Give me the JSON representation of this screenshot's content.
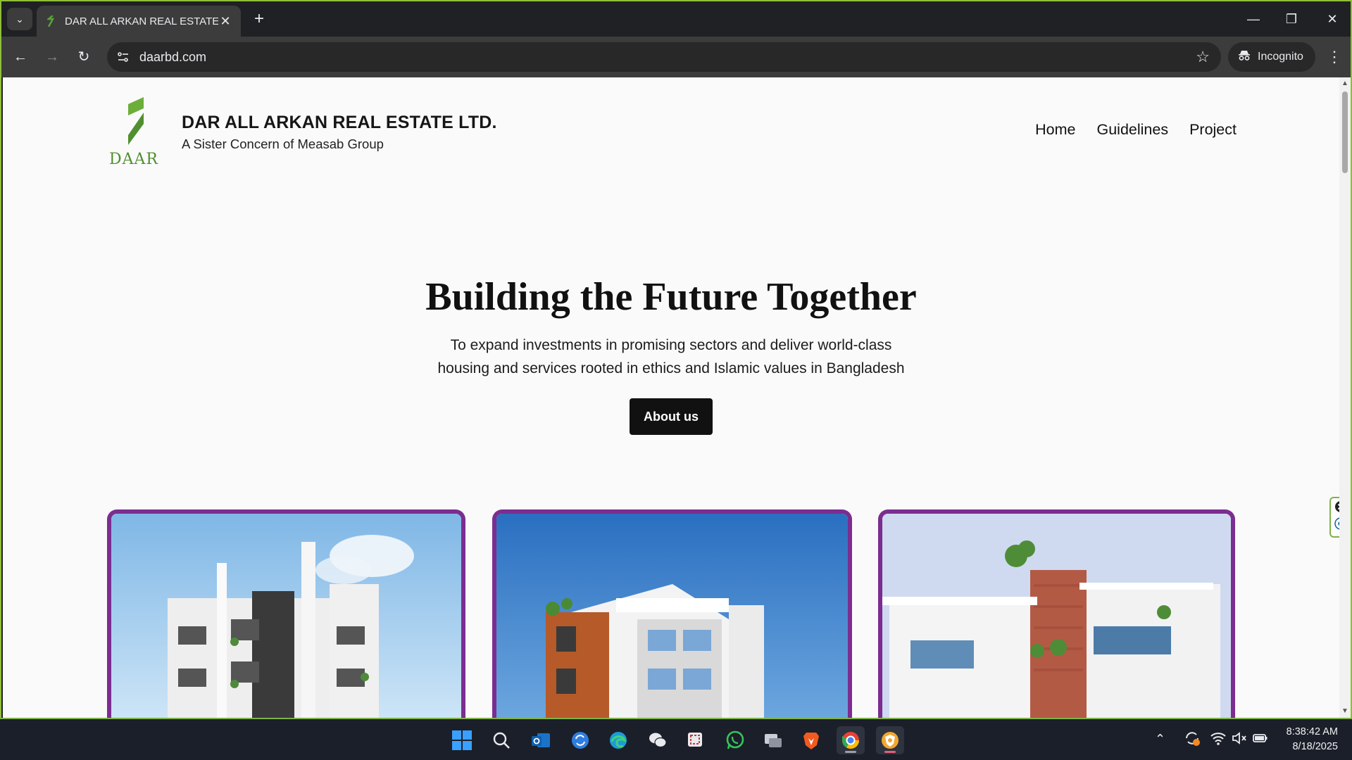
{
  "browser": {
    "tab_title": "DAR ALL ARKAN REAL ESTATE L",
    "url": "daarbd.com",
    "incognito_label": "Incognito"
  },
  "site": {
    "logo_text": "DAAR",
    "brand_title": "DAR ALL ARKAN REAL ESTATE LTD.",
    "brand_subtitle": "A Sister Concern of Measab Group",
    "nav": [
      "Home",
      "Guidelines",
      "Project"
    ],
    "hero_title": "Building the Future Together",
    "hero_text_line1": "To expand investments in promising sectors and deliver world-class",
    "hero_text_line2": "housing and services rooted in ethics and Islamic values in Bangladesh",
    "about_button": "About us",
    "accent_color": "#7b2d90",
    "brand_green": "#4f8f2f"
  },
  "taskbar": {
    "time": "8:38:42 AM",
    "date": "8/18/2025"
  }
}
